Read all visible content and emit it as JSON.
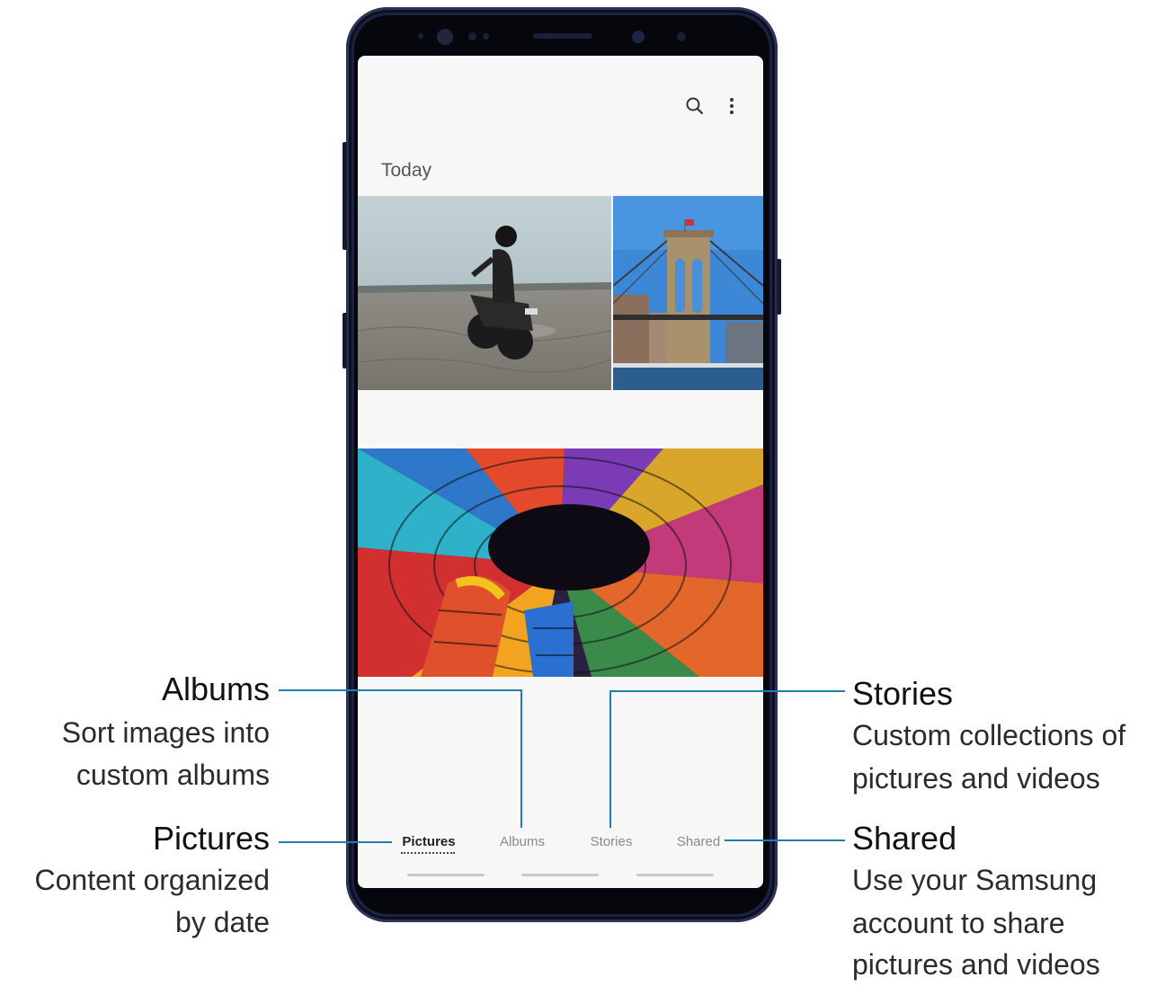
{
  "app": {
    "section_label": "Today",
    "toolbar": {
      "search_icon": "search-icon",
      "more_icon": "more-options-icon"
    },
    "photos": [
      "motorcycle-photo",
      "bridge-photo",
      "stained-glass-dome-photo"
    ],
    "tabs": [
      {
        "label": "Pictures",
        "active": true
      },
      {
        "label": "Albums",
        "active": false
      },
      {
        "label": "Stories",
        "active": false
      },
      {
        "label": "Shared",
        "active": false
      }
    ]
  },
  "callouts": {
    "albums": {
      "title": "Albums",
      "desc_line1": "Sort images into",
      "desc_line2": "custom albums"
    },
    "pictures": {
      "title": "Pictures",
      "desc_line1": "Content organized",
      "desc_line2": "by date"
    },
    "stories": {
      "title": "Stories",
      "desc_line1": "Custom collections of",
      "desc_line2": "pictures and videos"
    },
    "shared": {
      "title": "Shared",
      "desc_line1": "Use your Samsung",
      "desc_line2": "account to share",
      "desc_line3": "pictures and videos"
    }
  },
  "colors": {
    "accent": "#1f7fb3",
    "phone_body": "#1c2140",
    "screen_bg": "#f7f7f8"
  }
}
